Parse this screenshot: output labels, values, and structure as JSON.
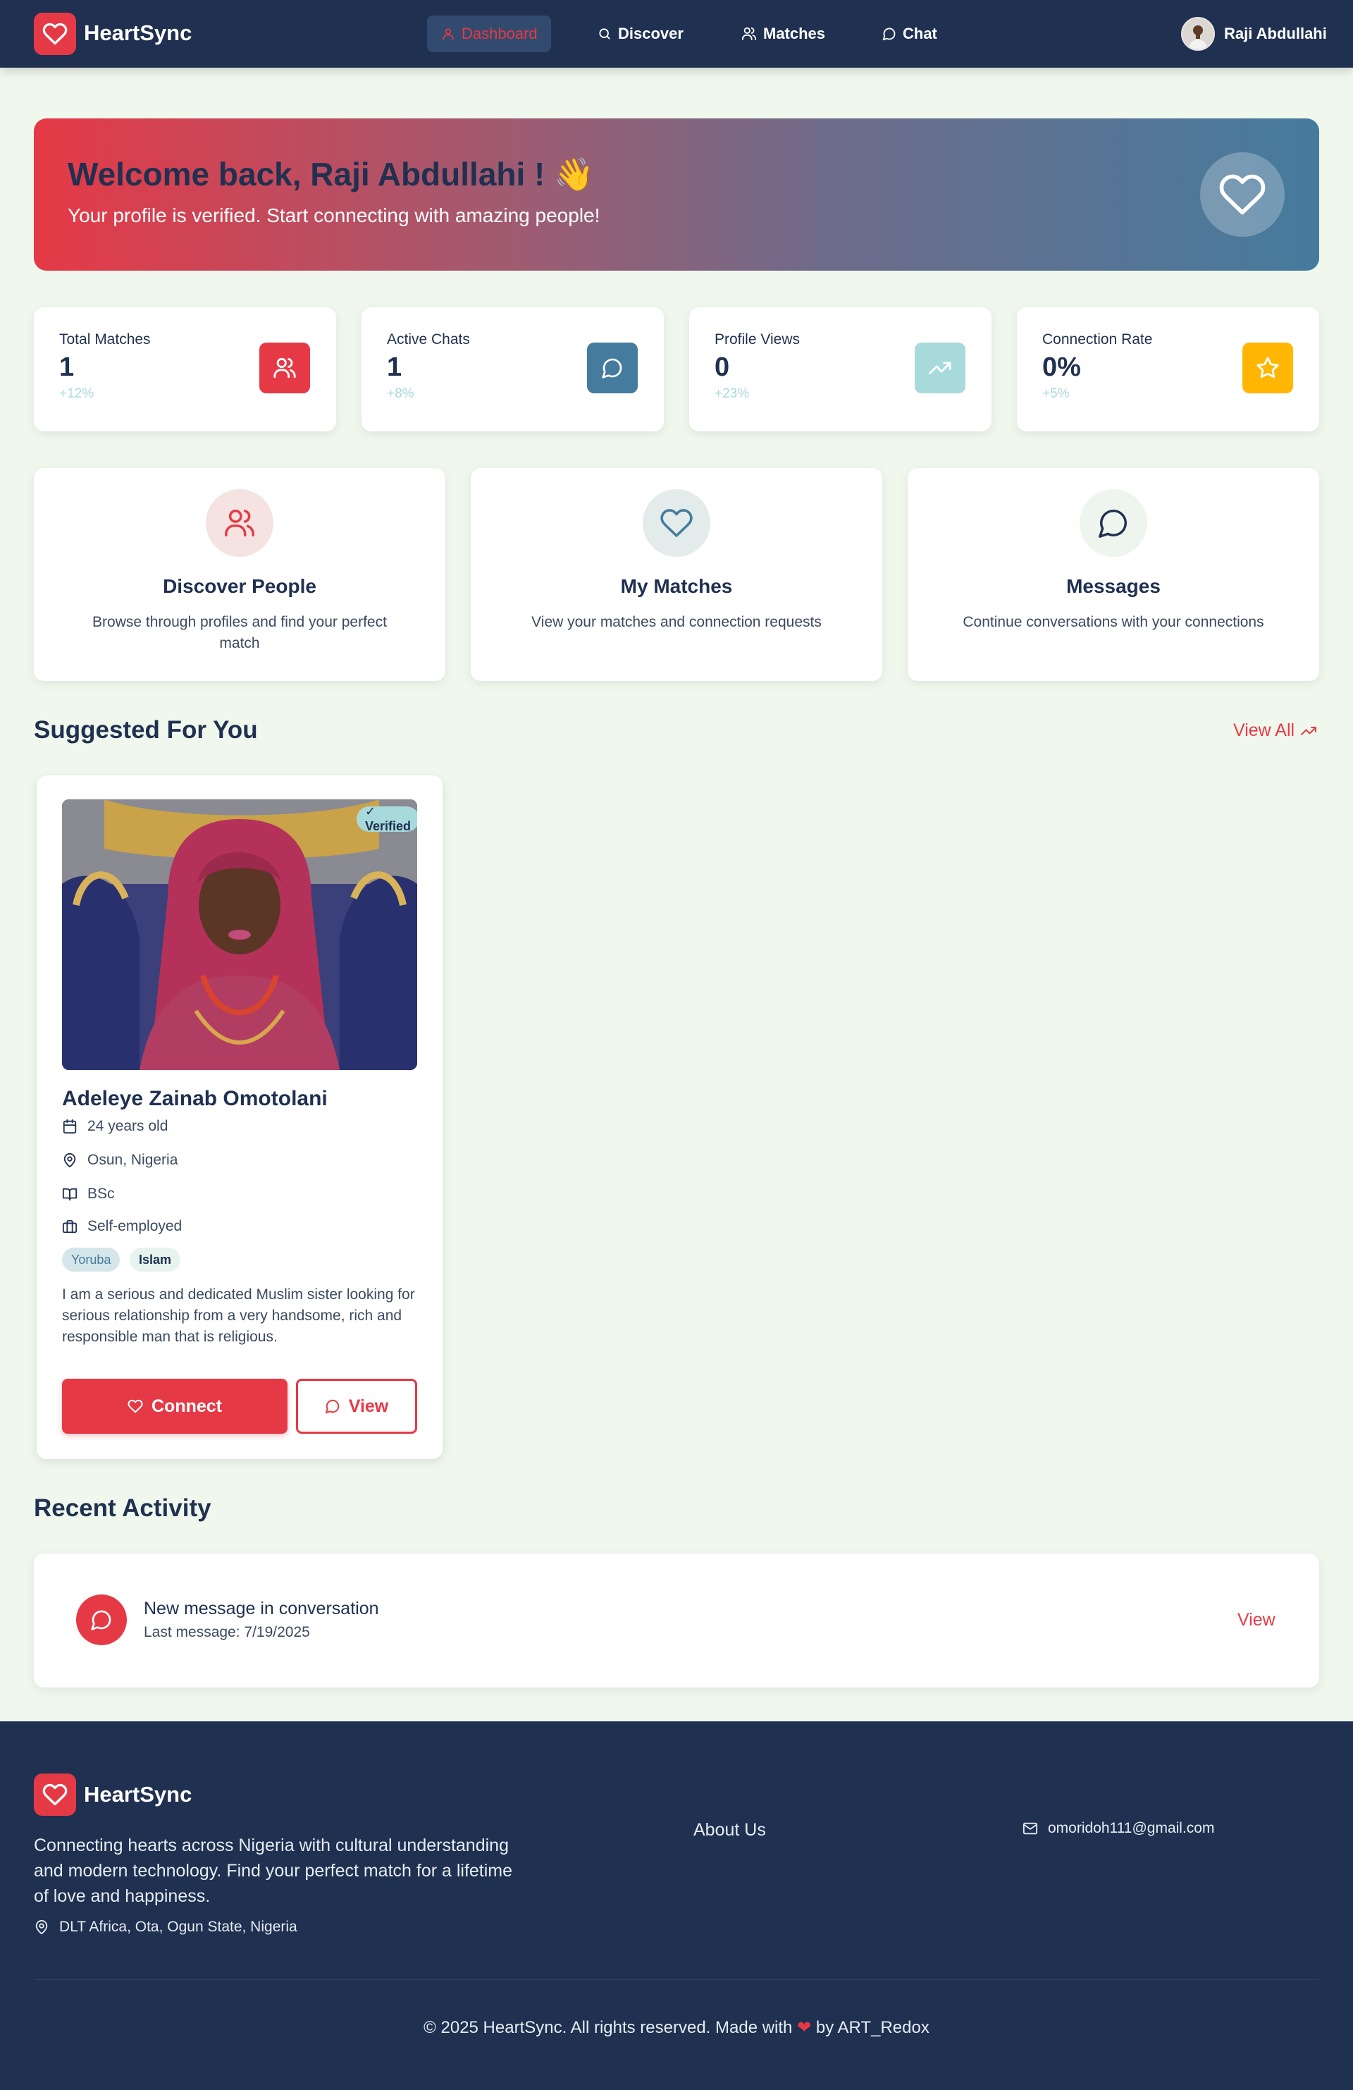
{
  "app": {
    "name": "HeartSync"
  },
  "nav": {
    "items": [
      {
        "label": "Dashboard",
        "icon": "user-icon",
        "active": true
      },
      {
        "label": "Discover",
        "icon": "search-icon",
        "active": false
      },
      {
        "label": "Matches",
        "icon": "users-icon",
        "active": false
      },
      {
        "label": "Chat",
        "icon": "chat-icon",
        "active": false
      }
    ],
    "user_name": "Raji Abdullahi"
  },
  "welcome": {
    "title": "Welcome back, Raji Abdullahi ! 👋",
    "subtitle": "Your profile is verified. Start connecting with amazing people!"
  },
  "stats": [
    {
      "label": "Total Matches",
      "value": "1",
      "change": "+12%",
      "icon": "users-icon",
      "color": "#e63946"
    },
    {
      "label": "Active Chats",
      "value": "1",
      "change": "+8%",
      "icon": "chat-icon",
      "color": "#457b9d"
    },
    {
      "label": "Profile Views",
      "value": "0",
      "change": "+23%",
      "icon": "trending-up-icon",
      "color": "#a8dadc"
    },
    {
      "label": "Connection Rate",
      "value": "0%",
      "change": "+5%",
      "icon": "star-icon",
      "color": "#ffb703"
    }
  ],
  "features": [
    {
      "title": "Discover People",
      "description": "Browse through profiles and find your perfect match",
      "icon": "users-icon"
    },
    {
      "title": "My Matches",
      "description": "View your matches and connection requests",
      "icon": "heart-icon"
    },
    {
      "title": "Messages",
      "description": "Continue conversations with your connections",
      "icon": "chat-icon"
    }
  ],
  "suggested": {
    "title": "Suggested For You",
    "view_all": "View All",
    "profile": {
      "verified_label": "✓ Verified",
      "name": "Adeleye Zainab Omotolani",
      "age": "24 years old",
      "location": "Osun, Nigeria",
      "education": "BSc",
      "occupation": "Self-employed",
      "tags": [
        "Yoruba",
        "Islam"
      ],
      "bio": "I am a serious and dedicated Muslim sister looking for serious relationship from a very handsome, rich and responsible man that is religious.",
      "connect_label": "Connect",
      "view_label": "View"
    }
  },
  "activity": {
    "title": "Recent Activity",
    "items": [
      {
        "title": "New message in conversation",
        "subtitle": "Last message: 7/19/2025",
        "action": "View"
      }
    ]
  },
  "footer": {
    "name": "HeartSync",
    "description": "Connecting hearts across Nigeria with cultural understanding and modern technology. Find your perfect match for a lifetime of love and happiness.",
    "address": "DLT Africa, Ota, Ogun State, Nigeria",
    "about_link": "About Us",
    "email": "omoridoh111@gmail.com",
    "copyright_before": "© 2025 HeartSync. All rights reserved. Made with",
    "copyright_after": "by ART_Redox"
  },
  "colors": {
    "primary": "#e63946",
    "navy": "#1f3050",
    "steel_blue": "#457b9d",
    "light_teal": "#a8dadc",
    "amber": "#ffb703",
    "page_bg": "#f0f8ee"
  }
}
